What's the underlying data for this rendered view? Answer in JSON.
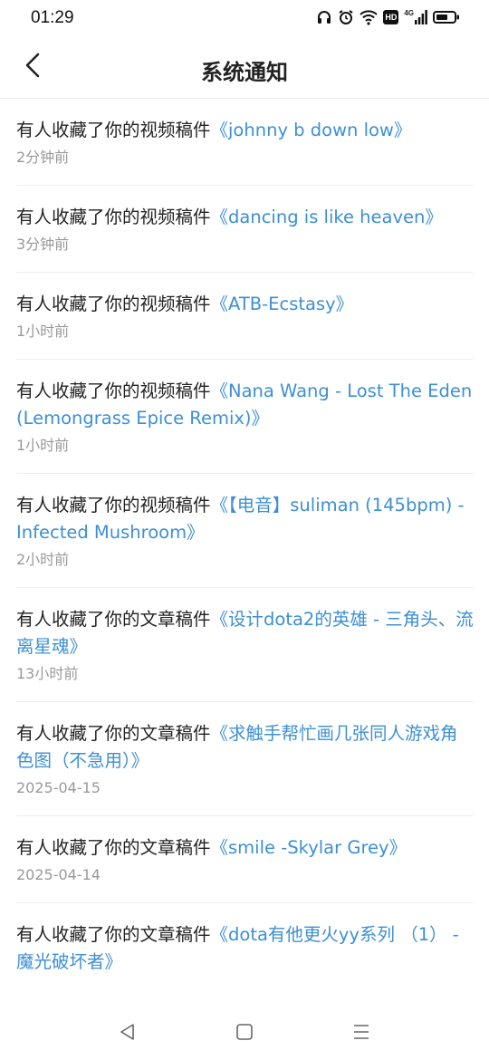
{
  "status_bar": {
    "time": "01:29",
    "icons": [
      "headphones-icon",
      "alarm-icon",
      "wifi-icon",
      "hd-icon",
      "signal-4g-icon",
      "battery-icon"
    ],
    "hd_label": "HD",
    "network_label": "4G"
  },
  "header": {
    "title": "系统通知",
    "back_icon": "chevron-left-icon"
  },
  "colors": {
    "link": "#3d8fd4",
    "text": "#222222",
    "timestamp": "#999999",
    "divider": "#eeeeee"
  },
  "notifications": [
    {
      "prefix": "有人收藏了你的视频稿件",
      "title": "《johnny b down low》",
      "time": "2分钟前"
    },
    {
      "prefix": "有人收藏了你的视频稿件",
      "title": "《dancing is like heaven》",
      "time": "3分钟前"
    },
    {
      "prefix": "有人收藏了你的视频稿件",
      "title": "《ATB-Ecstasy》",
      "time": "1小时前"
    },
    {
      "prefix": "有人收藏了你的视频稿件",
      "title": "《Nana Wang - Lost The Eden (Lemongrass Epice Remix)》",
      "time": "1小时前"
    },
    {
      "prefix": "有人收藏了你的视频稿件",
      "title": "《【电音】suliman (145bpm) - Infected Mushroom》",
      "time": "2小时前"
    },
    {
      "prefix": "有人收藏了你的文章稿件",
      "title": "《设计dota2的英雄 - 三角头、流离星魂》",
      "time": "13小时前"
    },
    {
      "prefix": "有人收藏了你的文章稿件",
      "title": "《求触手帮忙画几张同人游戏角色图（不急用）》",
      "time": "2025-04-15"
    },
    {
      "prefix": "有人收藏了你的文章稿件",
      "title": "《smile -Skylar Grey》",
      "time": "2025-04-14"
    },
    {
      "prefix": "有人收藏了你的文章稿件",
      "title": "《dota有他更火yy系列 （1） - 魔光破坏者》",
      "time": ""
    }
  ],
  "nav_bar": {
    "icons": [
      "back-triangle-icon",
      "home-square-icon",
      "menu-lines-icon"
    ]
  }
}
